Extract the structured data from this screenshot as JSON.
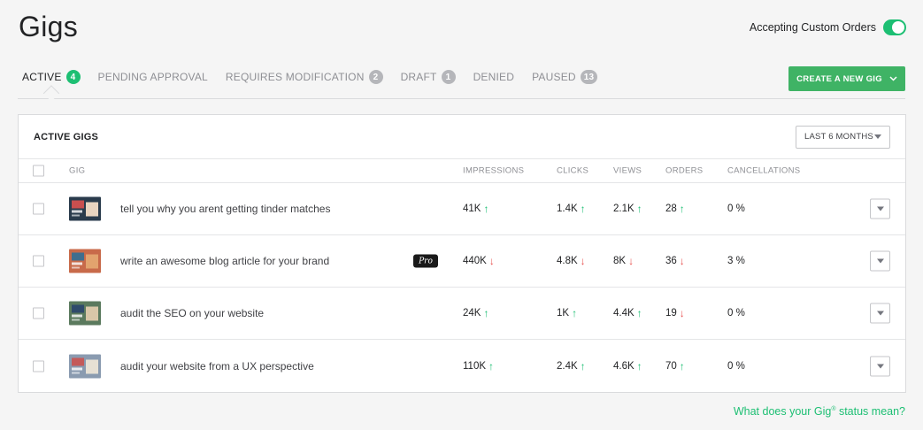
{
  "page": {
    "title": "Gigs"
  },
  "custom_orders": {
    "label": "Accepting Custom Orders",
    "enabled": true,
    "toggle_color": "#1dbf73"
  },
  "tabs": [
    {
      "label": "ACTIVE",
      "count": "4",
      "active": true
    },
    {
      "label": "PENDING APPROVAL",
      "count": ""
    },
    {
      "label": "REQUIRES MODIFICATION",
      "count": "2"
    },
    {
      "label": "DRAFT",
      "count": "1"
    },
    {
      "label": "DENIED",
      "count": ""
    },
    {
      "label": "PAUSED",
      "count": "13"
    }
  ],
  "create_button": {
    "label": "CREATE A NEW GIG",
    "color": "#3fb365"
  },
  "panel": {
    "title": "ACTIVE GIGS",
    "period_select": "LAST 6 MONTHS"
  },
  "table": {
    "columns": {
      "gig": "GIG",
      "impressions": "IMPRESSIONS",
      "clicks": "CLICKS",
      "views": "VIEWS",
      "orders": "ORDERS",
      "cancellations": "CANCELLATIONS"
    },
    "rows": [
      {
        "title": "tell you why you arent getting tinder matches",
        "pro": false,
        "impressions": "41K",
        "impressions_trend": "up",
        "clicks": "1.4K",
        "clicks_trend": "up",
        "views": "2.1K",
        "views_trend": "up",
        "orders": "28",
        "orders_trend": "up",
        "cancellations": "0 %"
      },
      {
        "title": "write an awesome blog article for your brand",
        "pro": true,
        "pro_label": "Pro",
        "impressions": "440K",
        "impressions_trend": "down",
        "clicks": "4.8K",
        "clicks_trend": "down",
        "views": "8K",
        "views_trend": "down",
        "orders": "36",
        "orders_trend": "down",
        "cancellations": "3 %"
      },
      {
        "title": "audit the SEO on your website",
        "pro": false,
        "impressions": "24K",
        "impressions_trend": "up",
        "clicks": "1K",
        "clicks_trend": "up",
        "views": "4.4K",
        "views_trend": "up",
        "orders": "19",
        "orders_trend": "down",
        "cancellations": "0 %"
      },
      {
        "title": "audit your website from a UX perspective",
        "pro": false,
        "impressions": "110K",
        "impressions_trend": "up",
        "clicks": "2.4K",
        "clicks_trend": "up",
        "views": "4.6K",
        "views_trend": "up",
        "orders": "70",
        "orders_trend": "up",
        "cancellations": "0 %"
      }
    ]
  },
  "footer": {
    "status_link_pre": "What does your Gig",
    "status_link_reg": "®",
    "status_link_post": " status mean?"
  }
}
